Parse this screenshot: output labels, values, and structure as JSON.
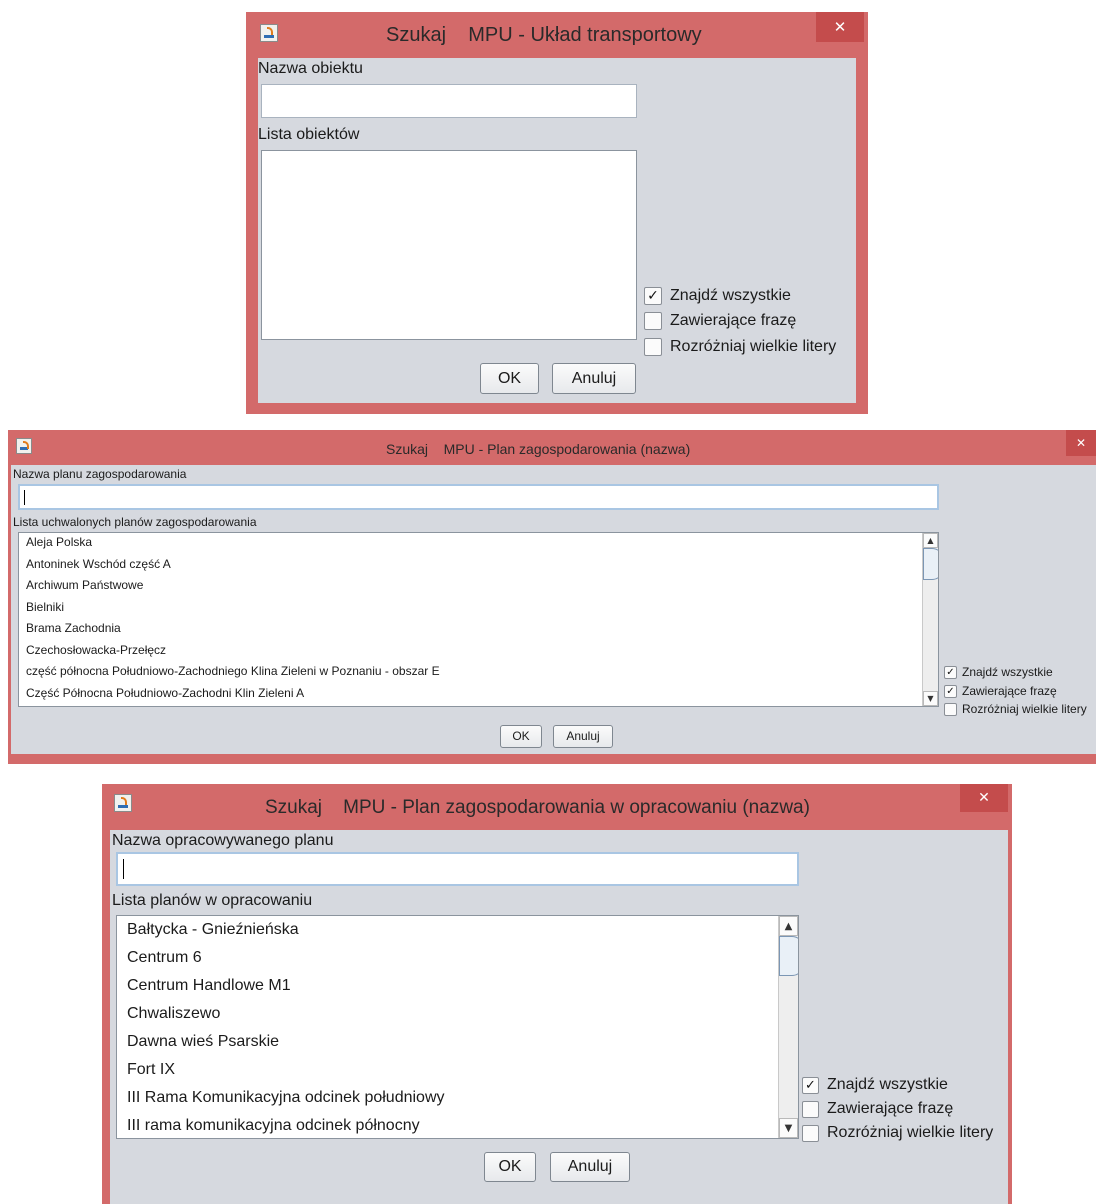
{
  "dialog1": {
    "title": "Szukaj    MPU - Układ transportowy",
    "close_glyph": "✕",
    "icon": "java-app-icon",
    "name_label": "Nazwa obiektu",
    "name_value": "",
    "list_label": "Lista obiektów",
    "list_items": [],
    "options": [
      {
        "label": "Znajdź wszystkie",
        "checked": true
      },
      {
        "label": "Zawierające frazę",
        "checked": false
      },
      {
        "label": "Rozróżniaj wielkie litery",
        "checked": false
      }
    ],
    "ok_label": "OK",
    "cancel_label": "Anuluj"
  },
  "dialog2": {
    "title": "Szukaj    MPU - Plan zagospodarowania (nazwa)",
    "close_glyph": "✕",
    "icon": "java-app-icon",
    "name_label": "Nazwa planu zagospodarowania",
    "name_value": "",
    "list_label": "Lista uchwalonych planów zagospodarowania",
    "list_items": [
      "Aleja Polska",
      "Antoninek Wschód część A",
      "Archiwum Państwowe",
      "Bielniki",
      "Brama Zachodnia",
      "Czechosłowacka-Przełęcz",
      "część północna Południowo-Zachodniego Klina Zieleni w Poznaniu - obszar E",
      "Część Północna Południowo-Zachodni Klin Zieleni A"
    ],
    "options": [
      {
        "label": "Znajdź wszystkie",
        "checked": true
      },
      {
        "label": "Zawierające frazę",
        "checked": true
      },
      {
        "label": "Rozróżniaj wielkie litery",
        "checked": false
      }
    ],
    "ok_label": "OK",
    "cancel_label": "Anuluj"
  },
  "dialog3": {
    "title": "Szukaj    MPU - Plan zagospodarowania w opracowaniu (nazwa)",
    "close_glyph": "✕",
    "icon": "java-app-icon",
    "name_label": "Nazwa opracowywanego planu",
    "name_value": "",
    "list_label": "Lista planów w opracowaniu",
    "list_items": [
      "Bałtycka - Gnieźnieńska",
      "Centrum 6",
      "Centrum Handlowe M1",
      "Chwaliszewo",
      "Dawna wieś Psarskie",
      "Fort IX",
      "III Rama Komunikacyjna odcinek południowy",
      "III rama komunikacyjna odcinek północny"
    ],
    "options": [
      {
        "label": "Znajdź wszystkie",
        "checked": true
      },
      {
        "label": "Zawierające frazę",
        "checked": false
      },
      {
        "label": "Rozróżniaj wielkie litery",
        "checked": false
      }
    ],
    "ok_label": "OK",
    "cancel_label": "Anuluj"
  },
  "scroll_arrows": {
    "up": "▲",
    "down": "▼"
  },
  "check_glyph": "✓"
}
